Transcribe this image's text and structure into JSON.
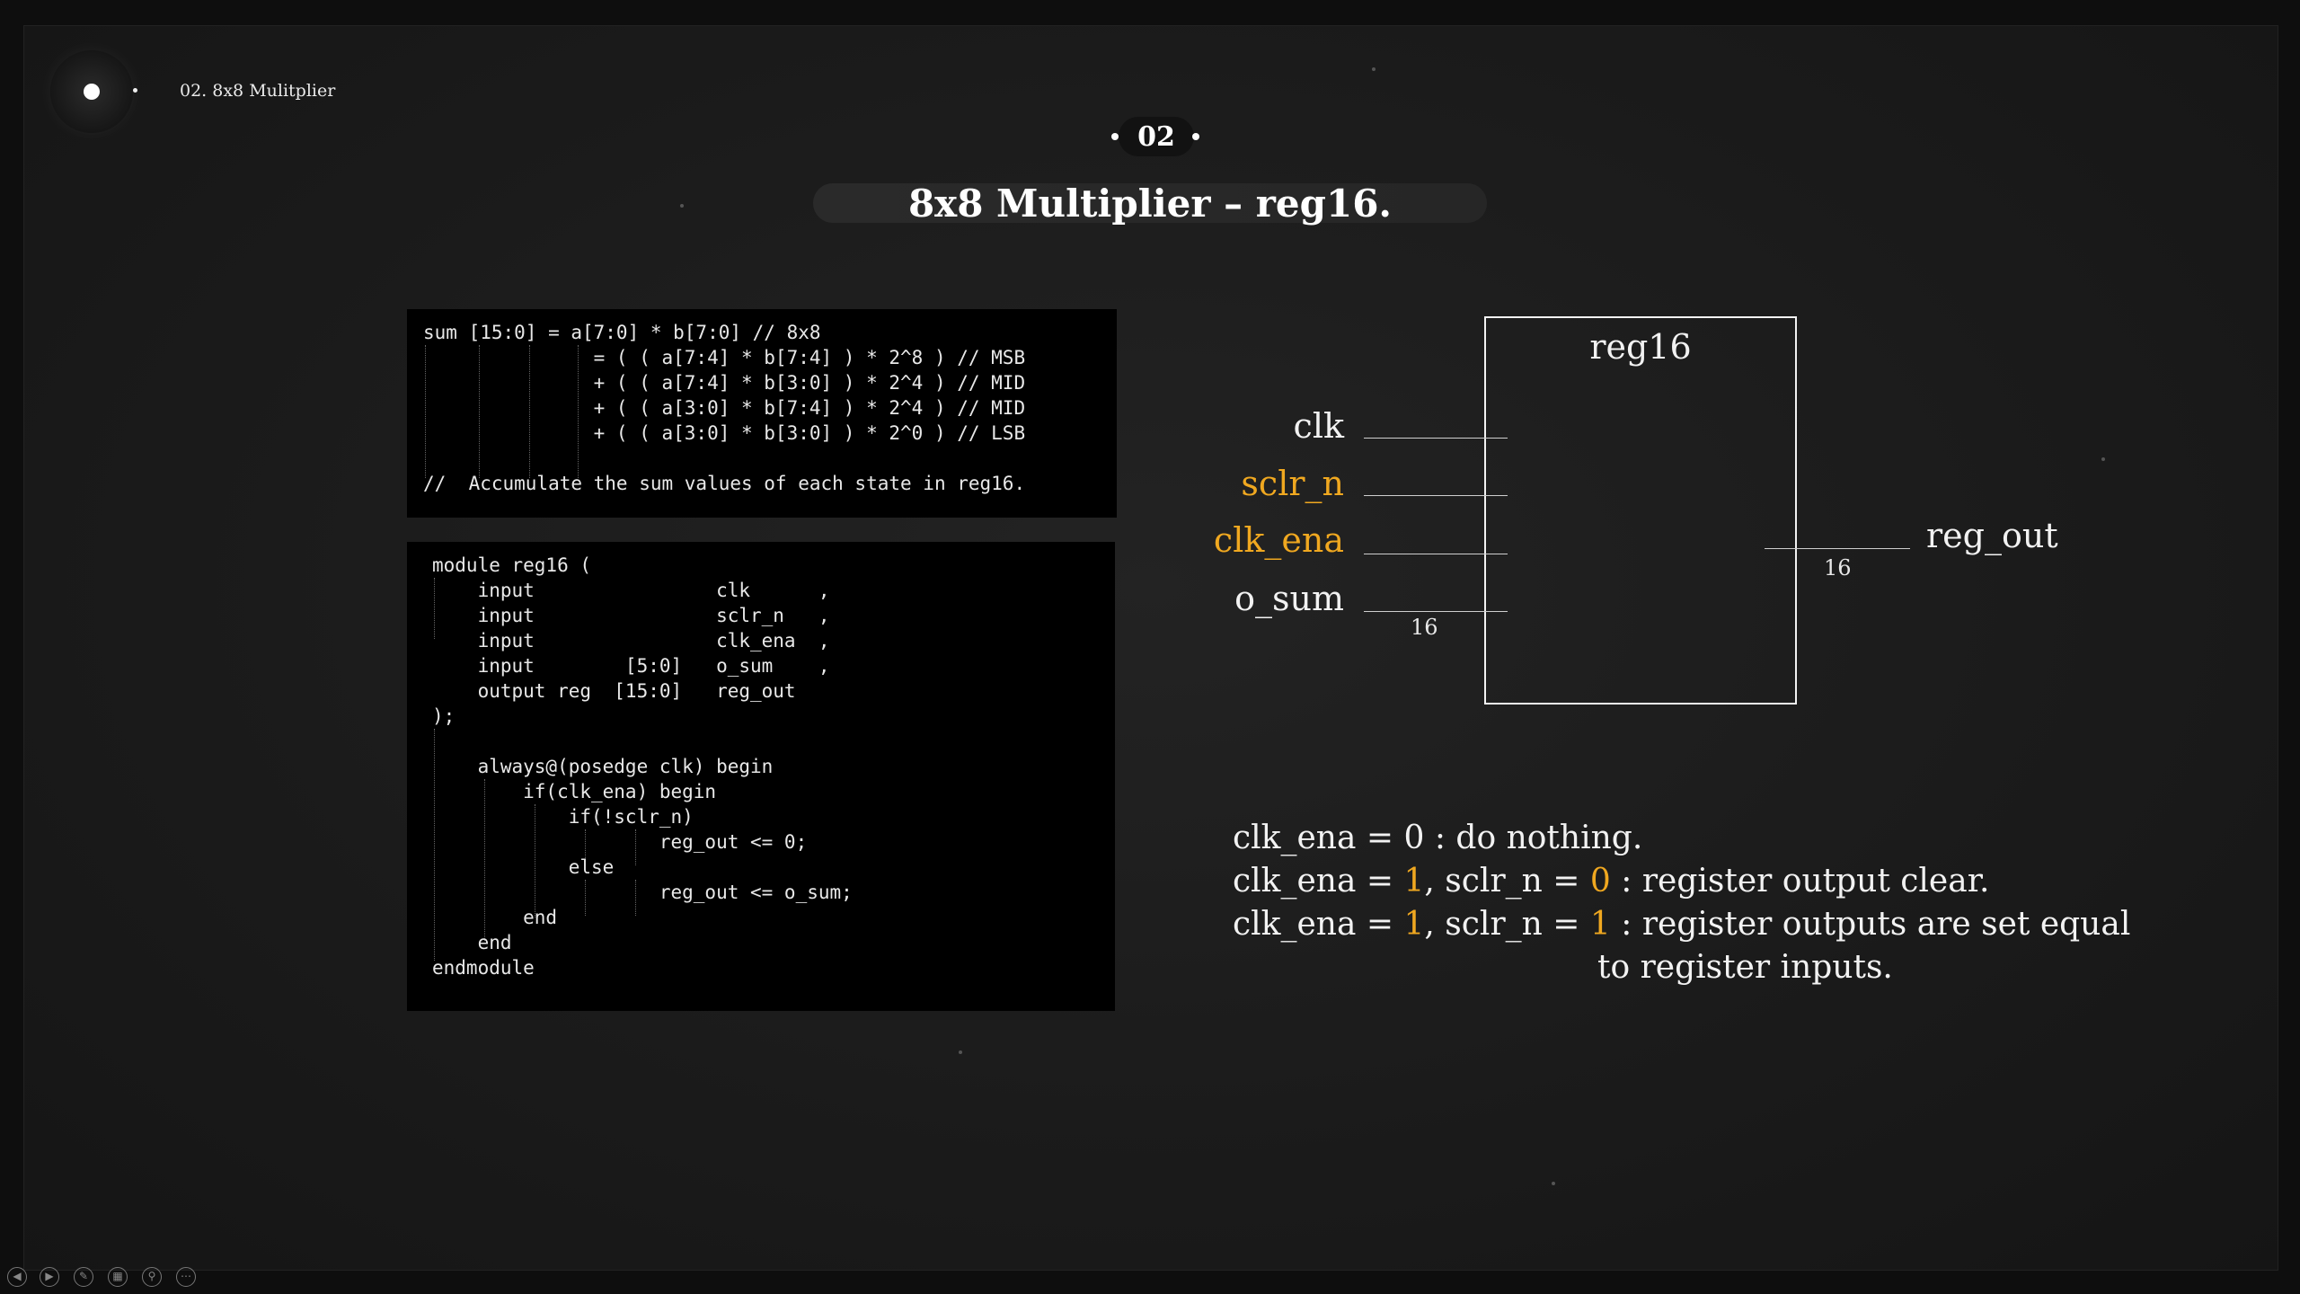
{
  "header": {
    "section_label": "02. 8x8 Mulitplier",
    "slide_number": "02",
    "title": "8x8 Multiplier – reg16."
  },
  "code_top": {
    "lines": [
      "sum [15:0] = a[7:0] * b[7:0] // 8x8",
      "               = ( ( a[7:4] * b[7:4] ) * 2^8 ) // MSB",
      "               + ( ( a[7:4] * b[3:0] ) * 2^4 ) // MID",
      "               + ( ( a[3:0] * b[7:4] ) * 2^4 ) // MID",
      "               + ( ( a[3:0] * b[3:0] ) * 2^0 ) // LSB",
      "",
      "//  Accumulate the sum values of each state in reg16."
    ]
  },
  "code_bottom": {
    "lines": [
      "module reg16 (",
      "    input                clk      ,",
      "    input                sclr_n   ,",
      "    input                clk_ena  ,",
      "    input        [5:0]   o_sum    ,",
      "    output reg  [15:0]   reg_out",
      ");",
      "",
      "    always@(posedge clk) begin",
      "        if(clk_ena) begin",
      "            if(!sclr_n)",
      "                    reg_out <= 0;",
      "            else",
      "                    reg_out <= o_sum;",
      "        end",
      "    end",
      "endmodule"
    ]
  },
  "diagram": {
    "block_name": "reg16",
    "inputs": [
      {
        "label": "clk",
        "highlight": false
      },
      {
        "label": "sclr_n",
        "highlight": true
      },
      {
        "label": "clk_ena",
        "highlight": true
      },
      {
        "label": "o_sum",
        "highlight": false
      }
    ],
    "input_bus_width": "16",
    "output": {
      "label": "reg_out",
      "bus_width": "16"
    }
  },
  "description": {
    "line1": {
      "a": "clk_ena = 0 : do nothing."
    },
    "line2": {
      "a": "clk_ena = ",
      "b": "1",
      "c": ", sclr_n = ",
      "d": "0",
      "e": " : register output clear."
    },
    "line3": {
      "a": "clk_ena = ",
      "b": "1",
      "c": ", sclr_n = ",
      "d": "1",
      "e": " : register outputs are set equal"
    },
    "line4": {
      "a": "to register inputs."
    }
  },
  "colors": {
    "highlight": "#f0a820",
    "background": "#1b1b1b",
    "code_background": "#000000"
  },
  "controls": [
    "prev-icon",
    "next-icon",
    "pen-icon",
    "slides-icon",
    "zoom-icon",
    "more-icon"
  ]
}
